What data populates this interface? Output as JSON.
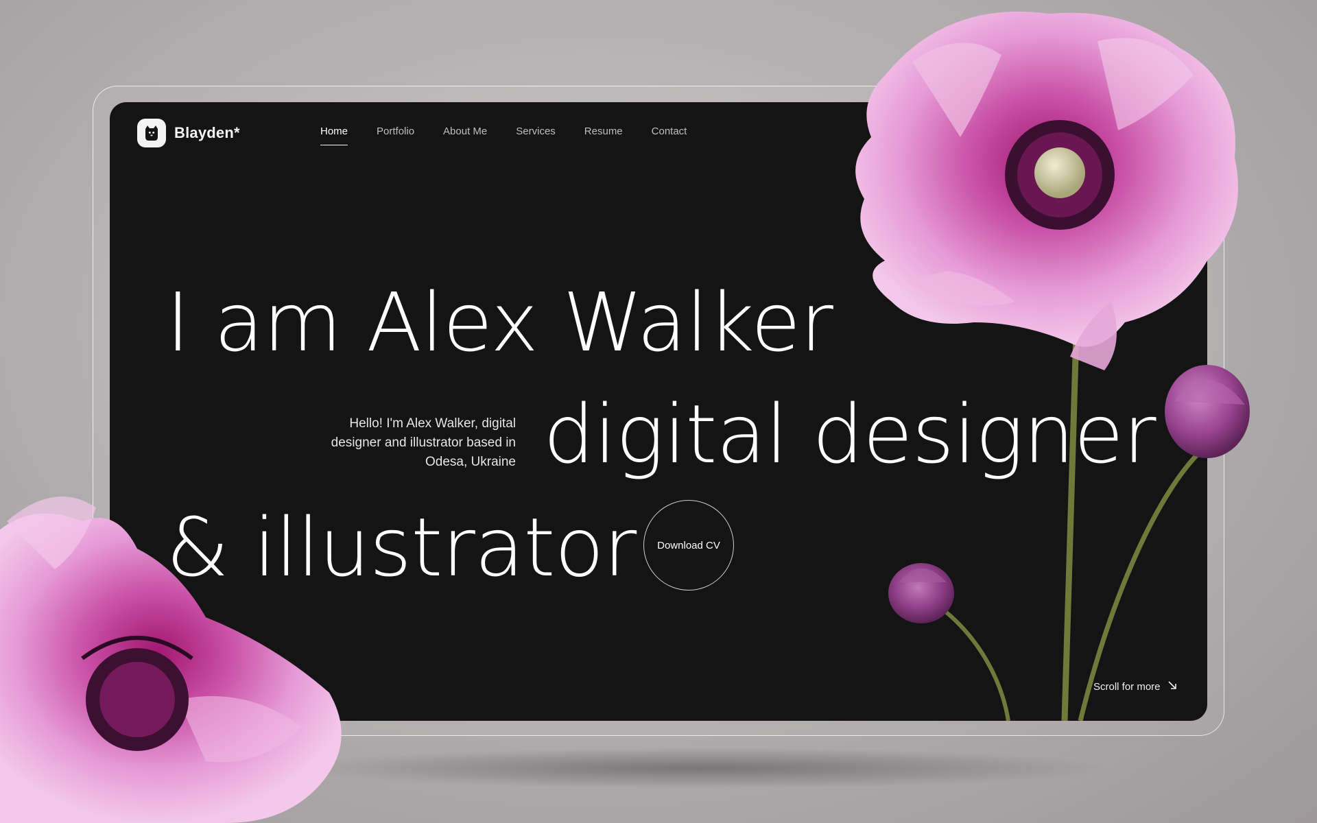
{
  "brand": {
    "name": "Blayden*"
  },
  "nav": {
    "items": [
      {
        "label": "Home"
      },
      {
        "label": "Portfolio"
      },
      {
        "label": "About Me"
      },
      {
        "label": "Services"
      },
      {
        "label": "Resume"
      },
      {
        "label": "Contact"
      }
    ],
    "active": "Home"
  },
  "hero": {
    "line1": "I am Alex Walker",
    "line2": "digital designer",
    "line3": "& illustrator",
    "intro_line1": "Hello! I'm Alex Walker, digital",
    "intro_line2": "designer and illustrator based in",
    "intro_line3": "Odesa, Ukraine",
    "cta_label": "Download CV",
    "scroll_label": "Scroll for more"
  },
  "icons": {
    "logo": "cat-face-icon",
    "scroll": "arrow-down-right-icon"
  },
  "colors": {
    "background": "#b5b1b2",
    "screen": "#141414",
    "text": "#ffffff",
    "petal": "#e59fd6",
    "petal_dark": "#b2338f",
    "stem": "#6f7a3a"
  }
}
